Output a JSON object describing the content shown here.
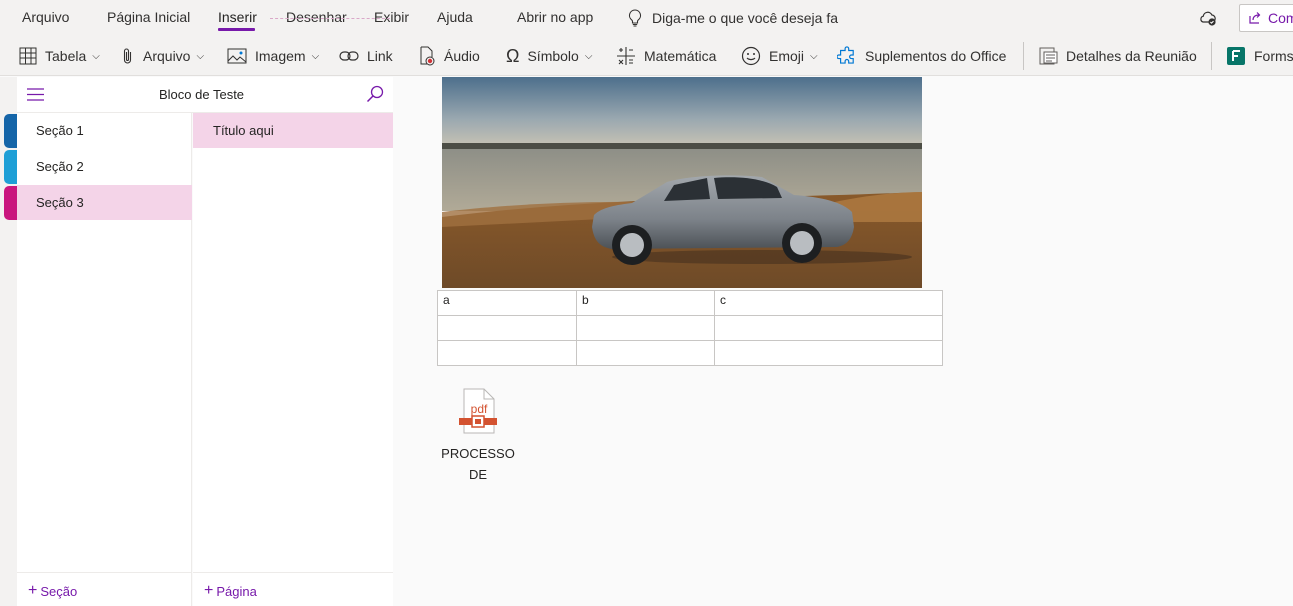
{
  "menubar": {
    "items": [
      "Arquivo",
      "Página Inicial",
      "Inserir",
      "Desenhar",
      "Exibir",
      "Ajuda",
      "Abrir no app"
    ],
    "active": "Inserir",
    "tell_me": "Diga-me o que você deseja fa",
    "share_label": "Com"
  },
  "ribbon": {
    "table": "Tabela",
    "file": "Arquivo",
    "image": "Imagem",
    "link": "Link",
    "audio": "Áudio",
    "symbol": "Símbolo",
    "math": "Matemática",
    "emoji": "Emoji",
    "addins": "Suplementos do Office",
    "meeting": "Detalhes da Reunião",
    "forms": "Forms"
  },
  "navigation": {
    "notebook_name": "Bloco de Teste",
    "sections": [
      {
        "label": "Seção 1",
        "color": "#1565a8",
        "selected": false
      },
      {
        "label": "Seção 2",
        "color": "#1e9fd6",
        "selected": false
      },
      {
        "label": "Seção 3",
        "color": "#c9167e",
        "selected": true
      }
    ],
    "pages": [
      {
        "label": "Título aqui",
        "selected": true
      }
    ],
    "add_section": "Seção",
    "add_page": "Página"
  },
  "content": {
    "table": {
      "rows": [
        [
          "a",
          "b",
          "c"
        ],
        [
          "",
          "",
          ""
        ],
        [
          "",
          "",
          ""
        ]
      ]
    },
    "attachment": {
      "type_label": "pdf",
      "name_line1": "PROCESSO",
      "name_line2": "DE"
    }
  },
  "colors": {
    "accent": "#7719aa",
    "selected_bg": "#f4d4e8",
    "pdf": "#d35230"
  }
}
